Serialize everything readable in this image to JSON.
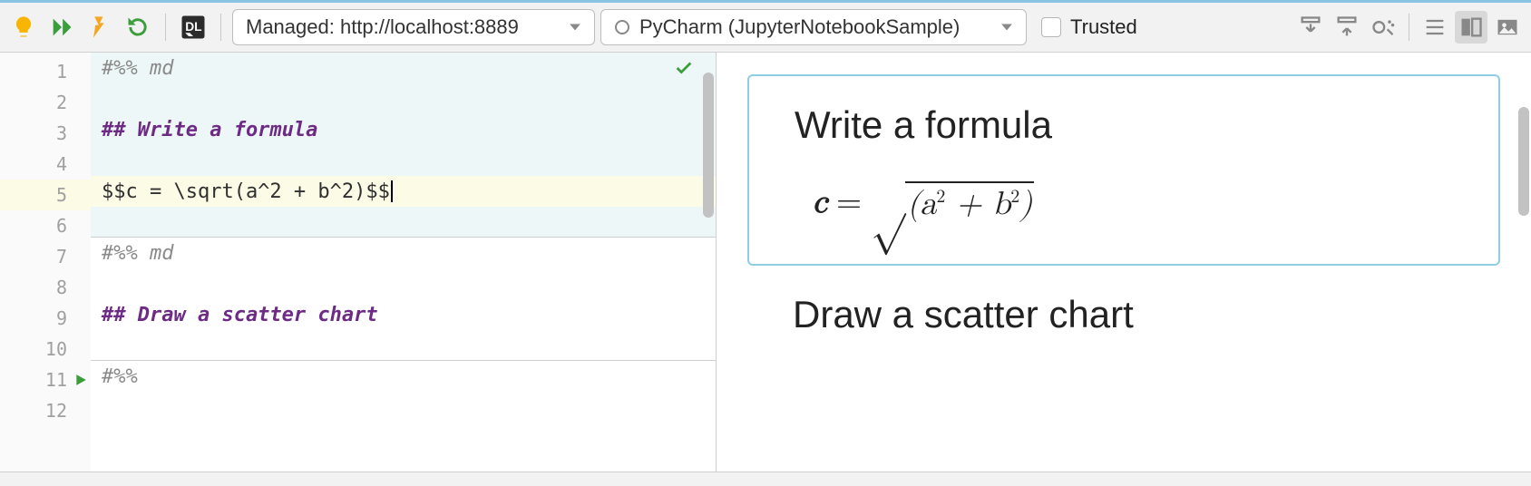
{
  "toolbar": {
    "server_dropdown": "Managed: http://localhost:8889",
    "kernel_dropdown": "PyCharm (JupyterNotebookSample)",
    "trusted_label": "Trusted"
  },
  "editor": {
    "lines": [
      {
        "n": "1",
        "text": "#%% md",
        "cls": "comment",
        "bg": "cell-md-bg",
        "delim": false
      },
      {
        "n": "2",
        "text": " ",
        "cls": "code-txt",
        "bg": "cell-md-bg"
      },
      {
        "n": "3",
        "text": "## Write a formula",
        "cls": "md-heading",
        "bg": "cell-md-bg",
        "widget": true
      },
      {
        "n": "4",
        "text": " ",
        "cls": "code-txt",
        "bg": "cell-md-bg"
      },
      {
        "n": "5",
        "text": "$$c = \\sqrt(a^2 + b^2)$$",
        "cls": "code-txt",
        "bg": "active-line-bg",
        "caret": true
      },
      {
        "n": "6",
        "text": " ",
        "cls": "code-txt",
        "bg": "cell-md-bg",
        "delim": true
      },
      {
        "n": "7",
        "text": "#%% md",
        "cls": "comment",
        "bg": "",
        "delim": false
      },
      {
        "n": "8",
        "text": " ",
        "cls": "code-txt",
        "bg": "",
        "widget": true
      },
      {
        "n": "9",
        "text": "## Draw a scatter chart",
        "cls": "md-heading",
        "bg": ""
      },
      {
        "n": "10",
        "text": " ",
        "cls": "code-txt",
        "bg": "",
        "delim": true
      },
      {
        "n": "11",
        "text": "#%%",
        "cls": "comment",
        "bg": "",
        "run": true
      },
      {
        "n": "12",
        "text": " ",
        "cls": "code-txt",
        "bg": ""
      }
    ]
  },
  "preview": {
    "heading1": "Write a formula",
    "heading2": "Draw a scatter chart"
  }
}
